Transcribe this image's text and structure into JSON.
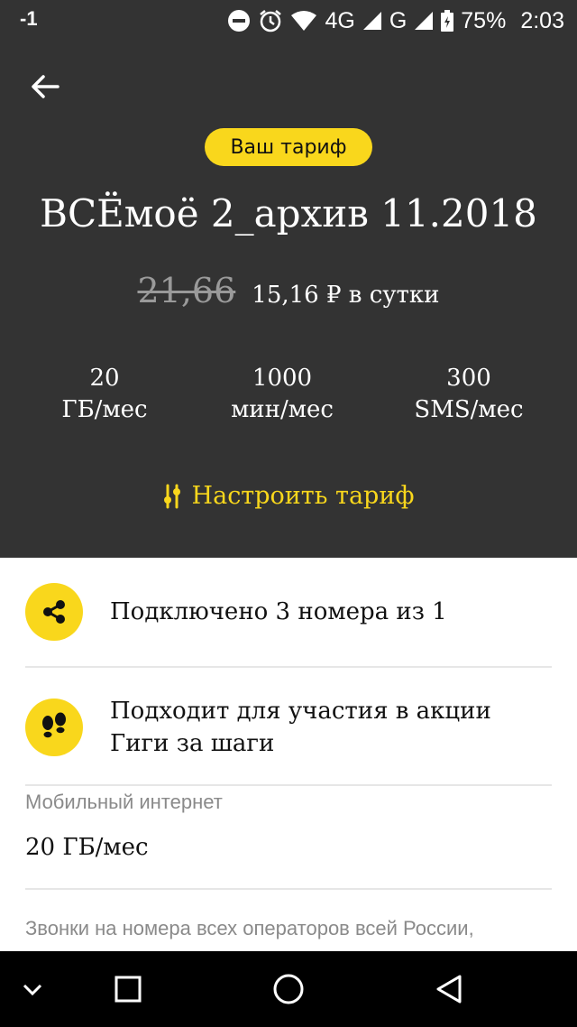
{
  "status_bar": {
    "left_text": "-1",
    "network_1": "4G",
    "network_2": "G",
    "battery": "75%",
    "time": "2:03"
  },
  "header": {
    "badge": "Ваш тариф",
    "tariff_name": "ВСЁмоё 2_архив 11.2018",
    "old_price": "21,66",
    "new_price": "15,16 ₽ в сутки",
    "features": [
      {
        "value": "20",
        "unit": "ГБ/мес"
      },
      {
        "value": "1000",
        "unit": "мин/мес"
      },
      {
        "value": "300",
        "unit": "SMS/мес"
      }
    ],
    "configure_label": "Настроить тариф"
  },
  "content": {
    "share_text": "Подключено 3 номера из 1",
    "promo_line1": "Подходит для участия в акции",
    "promo_line2": "Гиги за шаги",
    "internet_label": "Мобильный интернет",
    "internet_value": "20 ГБ/мес",
    "calls_text": "Звонки на номера всех операторов всей России,"
  },
  "colors": {
    "accent": "#f9d71c",
    "header_bg": "#333333"
  },
  "icons": [
    "back-arrow-icon",
    "share-icon",
    "footprints-icon",
    "sliders-icon"
  ]
}
